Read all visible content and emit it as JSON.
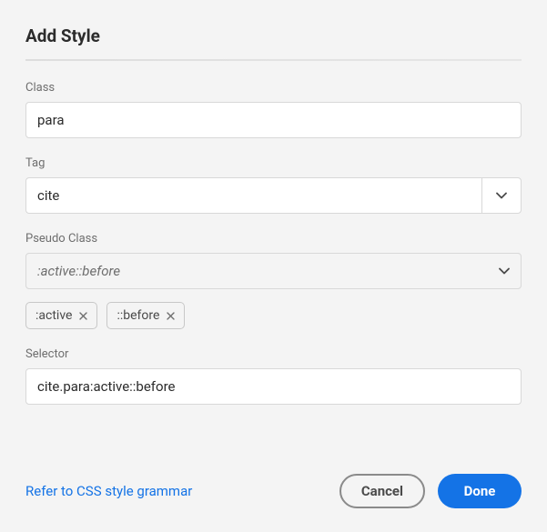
{
  "dialog": {
    "title": "Add Style",
    "fields": {
      "class": {
        "label": "Class",
        "value": "para"
      },
      "tag": {
        "label": "Tag",
        "value": "cite"
      },
      "pseudo": {
        "label": "Pseudo Class",
        "value": ":active::before"
      },
      "selector": {
        "label": "Selector",
        "value": "cite.para:active::before"
      }
    },
    "chips": [
      ":active",
      "::before"
    ],
    "footer": {
      "link": "Refer to CSS style grammar",
      "cancel": "Cancel",
      "done": "Done"
    }
  }
}
